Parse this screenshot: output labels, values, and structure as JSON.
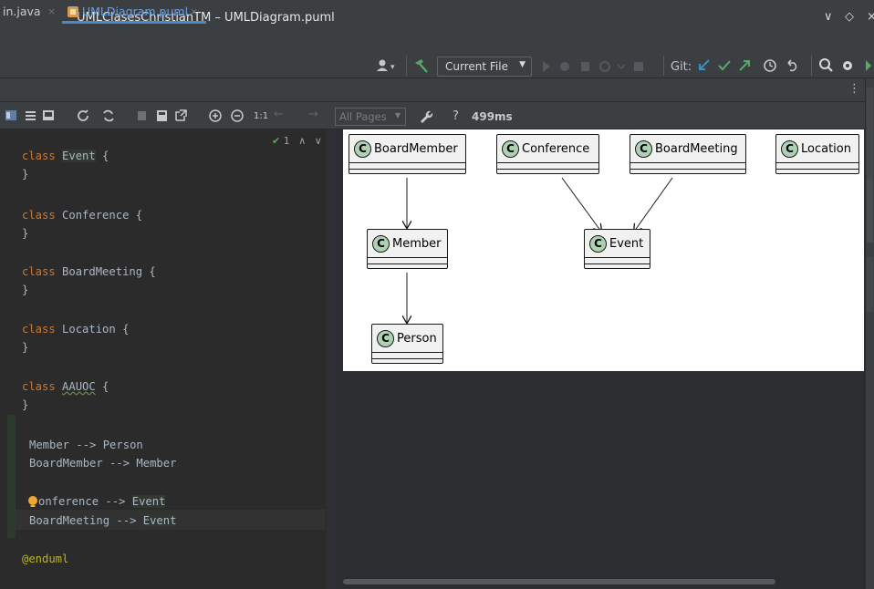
{
  "window": {
    "title": "UMLClasesChristianTM – UMLDiagram.puml",
    "controls": [
      "∨",
      "◇",
      "×"
    ]
  },
  "toolbar": {
    "user_icon_label": "▾",
    "run_config": "Current File",
    "git_label": "Git:"
  },
  "tabs": [
    {
      "label": "in.java",
      "close": "×"
    },
    {
      "label": "UMLDiagram.puml",
      "close": "×"
    }
  ],
  "preview_toolbar": {
    "zoom_reset": "1:1",
    "pages_select": "All Pages",
    "help": "?",
    "render_time": "499ms"
  },
  "editor": {
    "inspection_count": "1",
    "lines": [
      {
        "kw": "class",
        "name": "Event",
        "rest": " {"
      },
      {
        "close": "}"
      },
      {
        "kw": "class",
        "name": "Conference",
        "rest": " {"
      },
      {
        "close": "}"
      },
      {
        "kw": "class",
        "name": "BoardMeeting",
        "rest": " {"
      },
      {
        "close": "}"
      },
      {
        "kw": "class",
        "name": "Location",
        "rest": " {"
      },
      {
        "close": "}"
      },
      {
        "kw": "class",
        "name": "AAUOC",
        "rest": " {"
      },
      {
        "close": "}"
      }
    ],
    "relations": [
      {
        "from": "Member",
        "arrow": " --> ",
        "to": "Person"
      },
      {
        "from": "BoardMember",
        "arrow": " --> ",
        "to": "Member"
      },
      {
        "from": "onference",
        "arrow": " --> ",
        "to": "Event"
      },
      {
        "from": "BoardMeeting",
        "arrow": " --> ",
        "to": "Event"
      }
    ],
    "end_tag": "@enduml"
  },
  "diagram": {
    "classes": [
      {
        "id": "boardmember",
        "stereotype": "C",
        "name": "BoardMember"
      },
      {
        "id": "conference",
        "stereotype": "C",
        "name": "Conference"
      },
      {
        "id": "boardmeeting",
        "stereotype": "C",
        "name": "BoardMeeting"
      },
      {
        "id": "location",
        "stereotype": "C",
        "name": "Location"
      },
      {
        "id": "member",
        "stereotype": "C",
        "name": "Member"
      },
      {
        "id": "event",
        "stereotype": "C",
        "name": "Event"
      },
      {
        "id": "person",
        "stereotype": "C",
        "name": "Person"
      }
    ]
  },
  "colors": {
    "keyword": "#cc7832",
    "class_fill": "#f1f1f1",
    "class_badge": "#add1b2",
    "accent": "#4a88c7"
  }
}
